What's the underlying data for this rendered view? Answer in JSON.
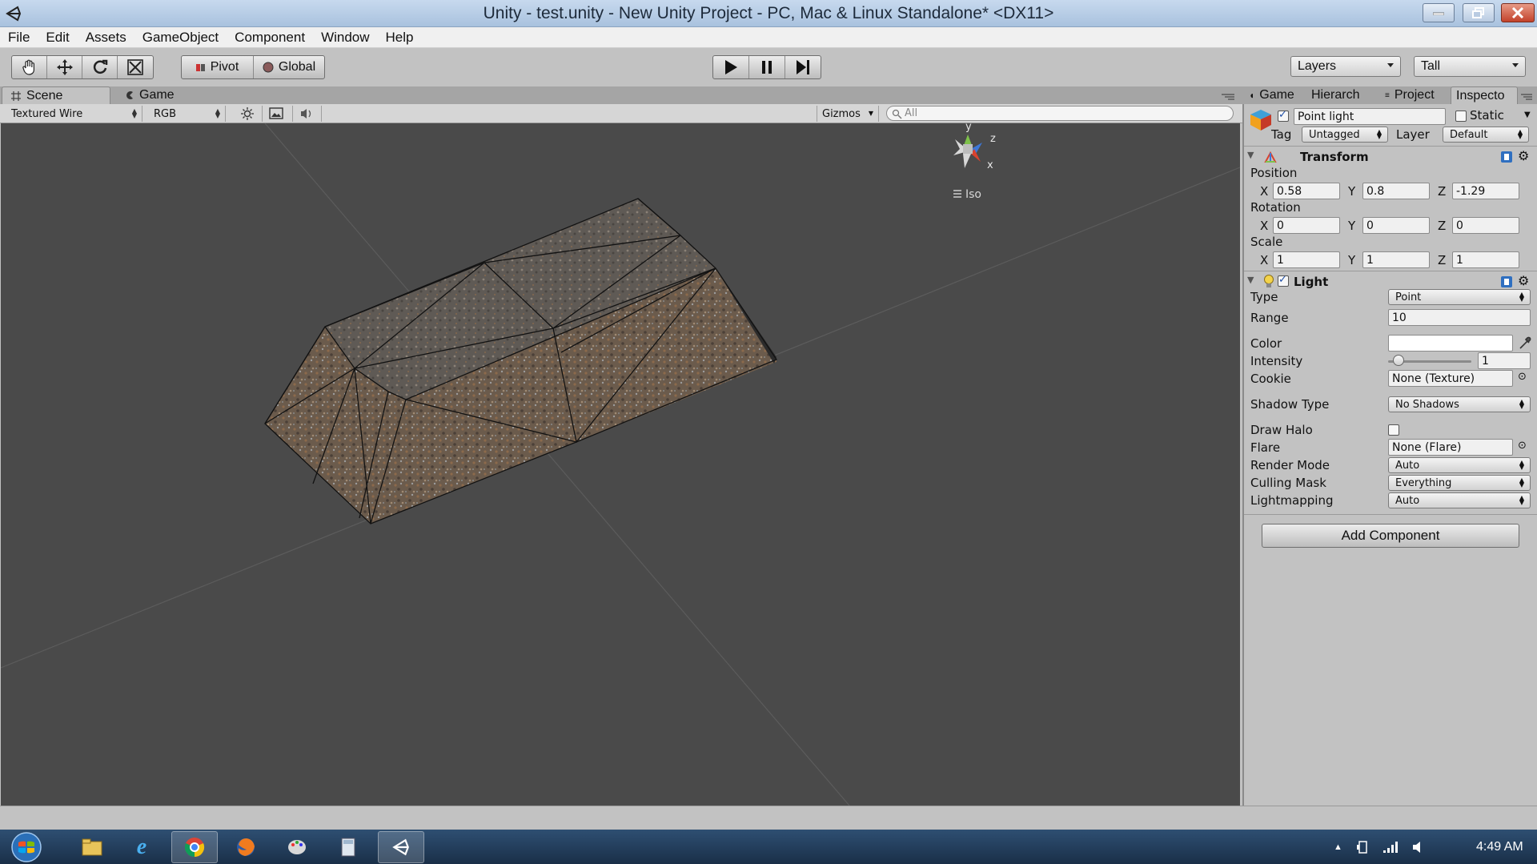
{
  "window": {
    "title": "Unity - test.unity - New Unity Project - PC, Mac & Linux Standalone* <DX11>"
  },
  "menu": [
    "File",
    "Edit",
    "Assets",
    "GameObject",
    "Component",
    "Window",
    "Help"
  ],
  "toolbar": {
    "pivot": "Pivot",
    "global": "Global",
    "layers": "Layers",
    "layout": "Tall"
  },
  "scene_tabs": {
    "scene": "Scene",
    "game": "Game"
  },
  "scene_bar": {
    "render_mode": "Textured Wire",
    "channel": "RGB",
    "gizmos": "Gizmos",
    "search_placeholder": "All"
  },
  "gizmo": {
    "y": "y",
    "z": "z",
    "x": "x",
    "projection": "Iso"
  },
  "inspector_tabs": [
    "Game",
    "Hierarch",
    "Project",
    "Inspecto"
  ],
  "object": {
    "name": "Point light",
    "active": true,
    "static_label": "Static",
    "tag_label": "Tag",
    "tag": "Untagged",
    "layer_label": "Layer",
    "layer": "Default"
  },
  "transform": {
    "title": "Transform",
    "position_label": "Position",
    "rotation_label": "Rotation",
    "scale_label": "Scale",
    "position": {
      "x": "0.58",
      "y": "0.8",
      "z": "-1.29"
    },
    "rotation": {
      "x": "0",
      "y": "0",
      "z": "0"
    },
    "scale": {
      "x": "1",
      "y": "1",
      "z": "1"
    },
    "axis_x": "X",
    "axis_y": "Y",
    "axis_z": "Z"
  },
  "light": {
    "title": "Light",
    "enabled": true,
    "type_label": "Type",
    "type": "Point",
    "range_label": "Range",
    "range": "10",
    "color_label": "Color",
    "color": "#ffffff",
    "intensity_label": "Intensity",
    "intensity": "1",
    "intensity_fraction": 0.125,
    "cookie_label": "Cookie",
    "cookie": "None (Texture)",
    "shadow_label": "Shadow Type",
    "shadow": "No Shadows",
    "halo_label": "Draw Halo",
    "halo": false,
    "flare_label": "Flare",
    "flare": "None (Flare)",
    "render_mode_label": "Render Mode",
    "render_mode": "Auto",
    "culling_label": "Culling Mask",
    "culling": "Everything",
    "lightmapping_label": "Lightmapping",
    "lightmapping": "Auto"
  },
  "add_component": "Add Component",
  "clock": "4:49 AM"
}
